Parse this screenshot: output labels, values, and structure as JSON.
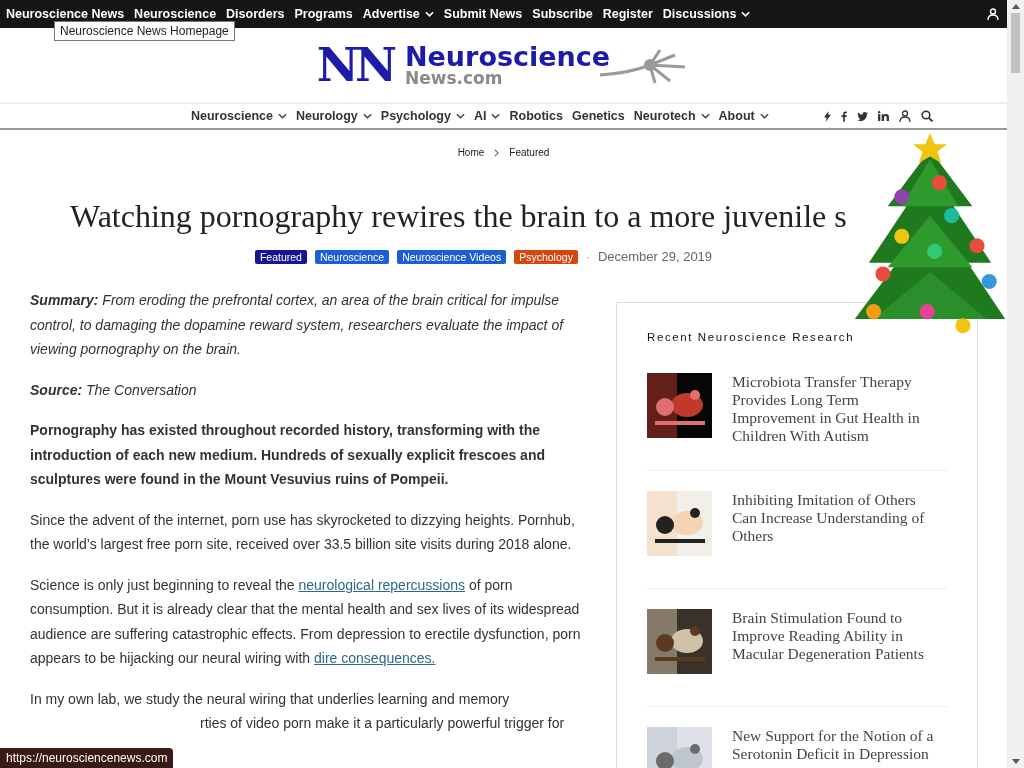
{
  "top_bar": {
    "items": [
      {
        "label": "Neuroscience News",
        "kind": "link"
      },
      {
        "label": "Neuroscience",
        "kind": "link"
      },
      {
        "label": "Disorders",
        "kind": "link"
      },
      {
        "label": "Programs",
        "kind": "link"
      },
      {
        "label": "Advertise",
        "kind": "dropdown"
      },
      {
        "label": "Submit News",
        "kind": "link"
      },
      {
        "label": "Subscribe",
        "kind": "link"
      },
      {
        "label": "Register",
        "kind": "link"
      },
      {
        "label": "Discussions",
        "kind": "dropdown"
      }
    ],
    "tooltip": "Neuroscience News Homepage"
  },
  "logo": {
    "mark": "NN",
    "line1": "Neuroscience",
    "line2": "News.com"
  },
  "main_nav": {
    "items": [
      {
        "label": "Neuroscience",
        "kind": "dropdown"
      },
      {
        "label": "Neurology",
        "kind": "dropdown"
      },
      {
        "label": "Psychology",
        "kind": "dropdown"
      },
      {
        "label": "AI",
        "kind": "dropdown"
      },
      {
        "label": "Robotics",
        "kind": "link"
      },
      {
        "label": "Genetics",
        "kind": "link"
      },
      {
        "label": "Neurotech",
        "kind": "dropdown"
      },
      {
        "label": "About",
        "kind": "dropdown"
      }
    ]
  },
  "breadcrumb": [
    "Home",
    "Featured"
  ],
  "article": {
    "title": "Watching pornography rewires the brain to a more juvenile s",
    "tags": [
      {
        "label": "Featured",
        "color": "#15158f"
      },
      {
        "label": "Neuroscience",
        "color": "#1d5fd1"
      },
      {
        "label": "Neuroscience Videos",
        "color": "#1d5fd1"
      },
      {
        "label": "Psychology",
        "color": "#d4470f"
      }
    ],
    "separator": "·",
    "date": "December 29, 2019",
    "paragraphs": [
      {
        "kind": "lead",
        "label": "Summary:",
        "text": "From eroding the prefrontal cortex, an area of the brain critical for impulse control, to damaging the dopamine reward system, researchers evaluate the impact of viewing pornography on the brain."
      },
      {
        "kind": "lead",
        "label": "Source:",
        "text": "The Conversation"
      },
      {
        "kind": "bold",
        "text": "Pornography has existed throughout recorded history, transforming with the introduction of each new medium. Hundreds of sexually explicit frescoes and sculptures were found in the Mount Vesuvius ruins of Pompeii."
      },
      {
        "kind": "plain",
        "text": "Since the advent of the internet, porn use has skyrocketed to dizzying heights. Pornhub, the world’s largest free porn site, received over 33.5 billion site visits during 2018 alone."
      },
      {
        "kind": "links",
        "parts": [
          {
            "text": "Science is only just beginning to reveal the",
            "link": false
          },
          {
            "text": "neurological repercussions",
            "link": true
          },
          {
            "text": "of porn consumption. But it is already clear that the mental health and sex lives of its widespread audience are suffering catastrophic effects. From depression to erectile dysfunction, porn appears to be hijacking our neural wiring with",
            "link": false
          },
          {
            "text": "dire consequences.",
            "link": true
          }
        ]
      },
      {
        "kind": "cut",
        "lines": [
          "In my own lab, we study the neural wiring that underlies learning and memory",
          "rties of video porn make it a particularly powerful trigger for"
        ]
      }
    ]
  },
  "sidebar": {
    "title": "Recent Neuroscience Research",
    "posts": [
      {
        "title": "Microbiota Transfer Therapy Provides Long Term Improvement in Gut Health in Children With Autism",
        "kind": "picture"
      },
      {
        "title": "Inhibiting Imitation of Others Can Increase Understanding of Others",
        "kind": "picture"
      },
      {
        "title": "Brain Stimulation Found to Improve Reading Ability in Macular Degeneration Patients",
        "kind": "picture"
      },
      {
        "title": "New Support for the Notion of a Serotonin Deficit in Depression",
        "kind": "picture"
      }
    ]
  },
  "status_bar": {
    "url": "https://neurosciencenews.com"
  }
}
